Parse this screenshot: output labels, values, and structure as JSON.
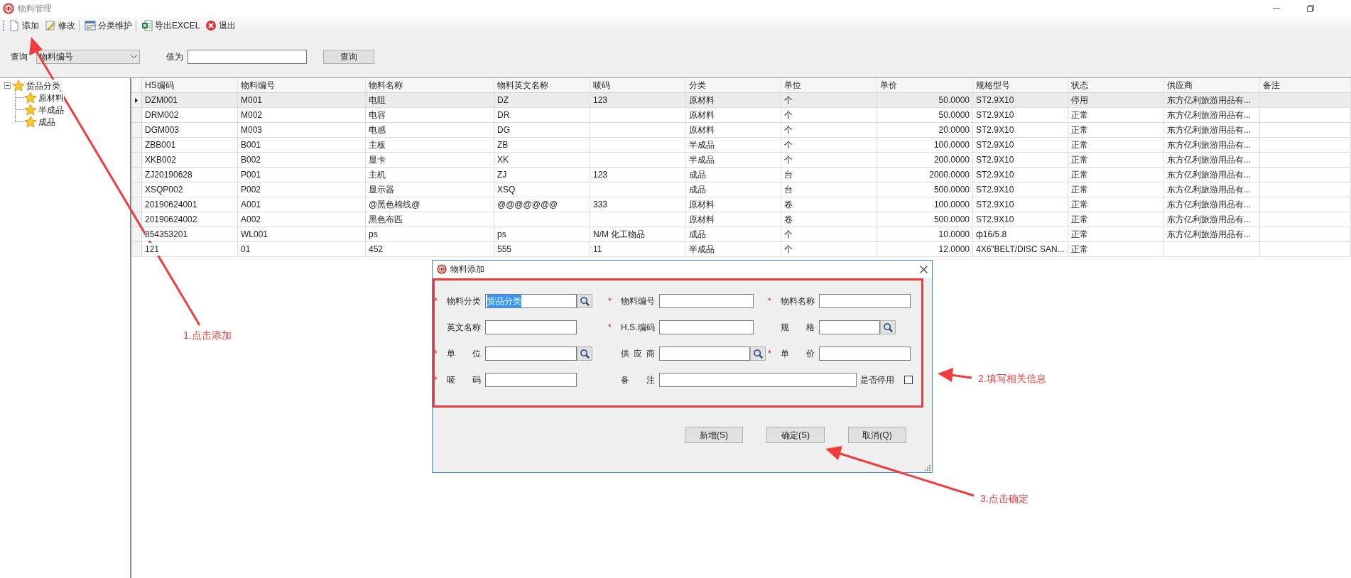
{
  "window": {
    "title": "物料管理"
  },
  "toolbar": [
    {
      "kind": "add",
      "label": "添加",
      "separator_after": false
    },
    {
      "kind": "edit",
      "label": "修改",
      "separator_after": true
    },
    {
      "kind": "category",
      "label": "分类维护",
      "separator_after": true
    },
    {
      "kind": "excel",
      "label": "导出EXCEL",
      "separator_after": false
    },
    {
      "kind": "exit",
      "label": "退出",
      "separator_after": false
    }
  ],
  "search": {
    "label": "查询",
    "field": "物料编号",
    "value_label": "值为",
    "button": "查询"
  },
  "tree": {
    "label": "货品分类",
    "expanded": true,
    "children": [
      {
        "label": "原材料"
      },
      {
        "label": "半成品"
      },
      {
        "label": "成品"
      }
    ]
  },
  "table": {
    "columns": [
      {
        "label": "HS编码"
      },
      {
        "label": "物料编号"
      },
      {
        "label": "物料名称"
      },
      {
        "label": "物料英文名称"
      },
      {
        "label": "唛码"
      },
      {
        "label": "分类"
      },
      {
        "label": "单位"
      },
      {
        "label": "单价",
        "numeric": true
      },
      {
        "label": "规格型号"
      },
      {
        "label": "状态"
      },
      {
        "label": "供应商"
      },
      {
        "label": "备注"
      }
    ],
    "rows": [
      {
        "selected": true,
        "cells": [
          "DZM001",
          "M001",
          "电阻",
          "DZ",
          "123",
          "原材料",
          "个",
          "50.0000",
          "ST2.9X10",
          "停用",
          "东方亿利旅游用品有...",
          ""
        ]
      },
      {
        "selected": false,
        "cells": [
          "DRM002",
          "M002",
          "电容",
          "DR",
          "",
          "原材料",
          "个",
          "50.0000",
          "ST2.9X10",
          "正常",
          "东方亿利旅游用品有...",
          ""
        ]
      },
      {
        "selected": false,
        "cells": [
          "DGM003",
          "M003",
          "电感",
          "DG",
          "",
          "原材料",
          "个",
          "20.0000",
          "ST2.9X10",
          "正常",
          "东方亿利旅游用品有...",
          ""
        ]
      },
      {
        "selected": false,
        "cells": [
          "ZBB001",
          "B001",
          "主板",
          "ZB",
          "",
          "半成品",
          "个",
          "100.0000",
          "ST2.9X10",
          "正常",
          "东方亿利旅游用品有...",
          ""
        ]
      },
      {
        "selected": false,
        "cells": [
          "XKB002",
          "B002",
          "显卡",
          "XK",
          "",
          "半成品",
          "个",
          "200.0000",
          "ST2.9X10",
          "正常",
          "东方亿利旅游用品有...",
          ""
        ]
      },
      {
        "selected": false,
        "cells": [
          "ZJ20190628",
          "P001",
          "主机",
          "ZJ",
          "123",
          "成品",
          "台",
          "2000.0000",
          "ST2.9X10",
          "正常",
          "东方亿利旅游用品有...",
          ""
        ]
      },
      {
        "selected": false,
        "cells": [
          "XSQP002",
          "P002",
          "显示器",
          "XSQ",
          "",
          "成品",
          "台",
          "500.0000",
          "ST2.9X10",
          "正常",
          "东方亿利旅游用品有...",
          ""
        ]
      },
      {
        "selected": false,
        "cells": [
          "20190624001",
          "A001",
          "@黑色棉线@",
          "@@@@@@@",
          "333",
          "原材料",
          "卷",
          "100.0000",
          "ST2.9X10",
          "正常",
          "东方亿利旅游用品有...",
          ""
        ]
      },
      {
        "selected": false,
        "cells": [
          "20190624002",
          "A002",
          "黑色布匹",
          "",
          "",
          "原材料",
          "卷",
          "500.0000",
          "ST2.9X10",
          "正常",
          "东方亿利旅游用品有...",
          ""
        ]
      },
      {
        "selected": false,
        "cells": [
          "854353201",
          "WL001",
          "ps",
          "ps",
          "N/M 化工物品",
          "成品",
          "个",
          "10.0000",
          "ф16/5.8",
          "正常",
          "东方亿利旅游用品有...",
          ""
        ]
      },
      {
        "selected": false,
        "cells": [
          "121",
          "01",
          "452",
          "555",
          "11",
          "半成品",
          "个",
          "12.0000",
          "4X6\"BELT/DISC SAN...",
          "正常",
          "",
          ""
        ]
      }
    ]
  },
  "dialog": {
    "title": "物料添加",
    "rows": [
      [
        {
          "kind": "text",
          "marker": "*",
          "label": "物料分类",
          "value": "货品分类",
          "highlighted": true,
          "lookup": true
        },
        {
          "kind": "text",
          "marker": "*",
          "label": "物料编号",
          "lookup": false
        },
        {
          "kind": "text",
          "marker": "*",
          "label": "物料名称",
          "lookup": false
        }
      ],
      [
        {
          "kind": "text",
          "label": "英文名称",
          "lookup": false
        },
        {
          "kind": "text",
          "marker": "*",
          "label": "H.S.编码",
          "lookup": false
        },
        {
          "kind": "text",
          "label": "规 格",
          "lookup": true
        }
      ],
      [
        {
          "kind": "text",
          "marker": "*",
          "label": "单 位",
          "lookup": true
        },
        {
          "kind": "text",
          "label": "供 应 商",
          "lookup": true
        },
        {
          "kind": "text",
          "marker": "*",
          "label": "单 价",
          "lookup": false
        }
      ],
      [
        {
          "kind": "text",
          "marker": "*",
          "label": "唛 码",
          "lookup": false
        },
        {
          "kind": "memo",
          "label": "备 注",
          "lookup": false
        },
        {
          "kind": "checkbox",
          "label": "是否停用",
          "checked": false
        }
      ]
    ],
    "buttons": [
      {
        "label": "新增(S)"
      },
      {
        "label": "确定(S)"
      },
      {
        "label": "取消(Q)"
      }
    ]
  },
  "annotations": [
    {
      "text": "1.点击添加"
    },
    {
      "text": "2.填写相关信息"
    },
    {
      "text": "3.点击确定"
    }
  ]
}
